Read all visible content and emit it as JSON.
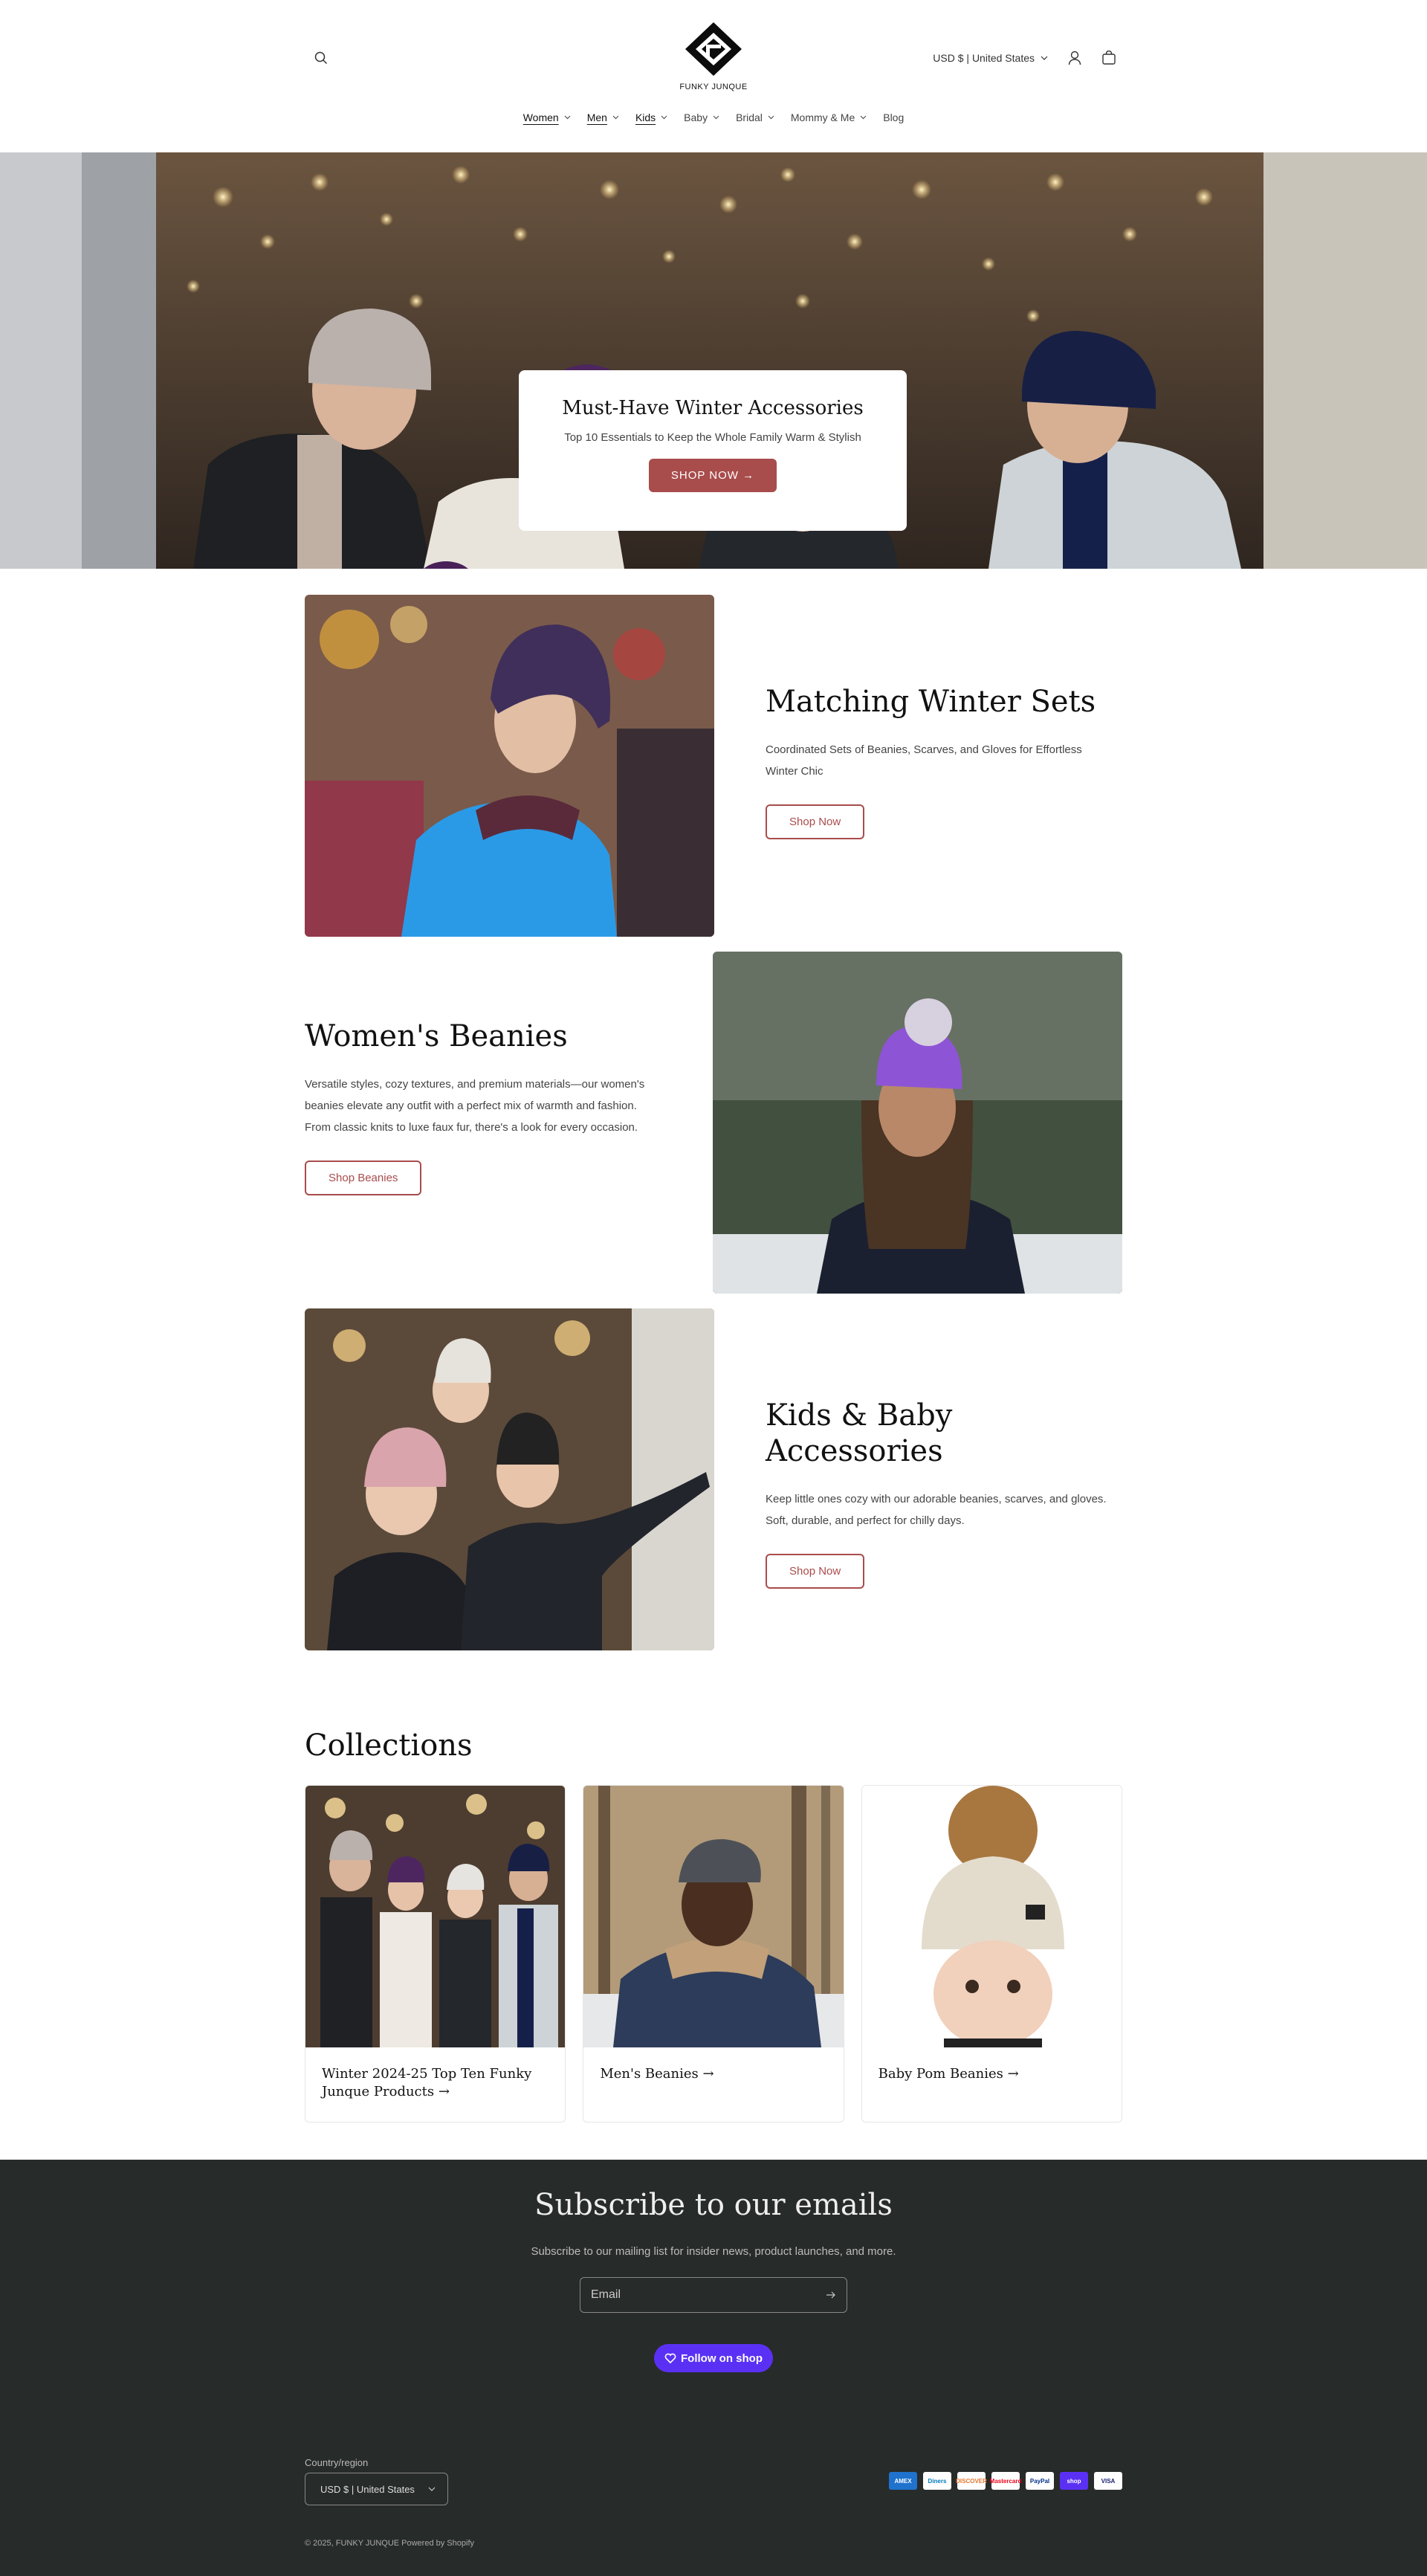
{
  "header": {
    "logo_text": "FUNKY JUNQUE",
    "currency_label": "USD $ | United States"
  },
  "nav": [
    {
      "label": "Women",
      "has_dropdown": true
    },
    {
      "label": "Men",
      "has_dropdown": true
    },
    {
      "label": "Kids",
      "has_dropdown": true
    },
    {
      "label": "Baby",
      "has_dropdown": true
    },
    {
      "label": "Bridal",
      "has_dropdown": true
    },
    {
      "label": "Mommy & Me",
      "has_dropdown": true
    },
    {
      "label": "Blog",
      "has_dropdown": false
    }
  ],
  "hero": {
    "title": "Must-Have Winter Accessories",
    "subtitle": "Top 10 Essentials to Keep the Whole Family Warm & Stylish",
    "button_label": "SHOP NOW →"
  },
  "features": [
    {
      "title": "Matching Winter Sets",
      "text": "Coordinated Sets of Beanies, Scarves, and Gloves for Effortless Winter Chic",
      "button_label": "Shop Now"
    },
    {
      "title": "Women's Beanies",
      "text": "Versatile styles, cozy textures, and premium materials—our women's beanies elevate any outfit with a perfect mix of warmth and fashion. From classic knits to luxe faux fur, there's a look for every occasion.",
      "button_label": "Shop Beanies"
    },
    {
      "title": "Kids & Baby Accessories",
      "text": "Keep little ones cozy with our adorable beanies, scarves, and gloves. Soft, durable, and perfect for chilly days.",
      "button_label": "Shop Now"
    }
  ],
  "collections": {
    "title": "Collections",
    "cards": [
      {
        "label": "Winter 2024-25 Top Ten Funky Junque Products →"
      },
      {
        "label": "Men's Beanies →"
      },
      {
        "label": "Baby Pom Beanies →"
      }
    ]
  },
  "footer": {
    "subscribe_title": "Subscribe to our emails",
    "subscribe_text": "Subscribe to our mailing list for insider news, product launches, and more.",
    "email_placeholder": "Email",
    "follow_label": "Follow on shop",
    "country_label": "Country/region",
    "country_value": "USD $ | United States",
    "payment_icons": [
      "AMEX",
      "Diners",
      "DISCOVER",
      "Mastercard",
      "PayPal",
      "shop",
      "VISA"
    ],
    "copyright": "© 2025, FUNKY JUNQUE Powered by Shopify"
  },
  "colors": {
    "accent": "#a94c4c",
    "footer_bg": "#272b29",
    "shop_purple": "#5a31f4"
  }
}
